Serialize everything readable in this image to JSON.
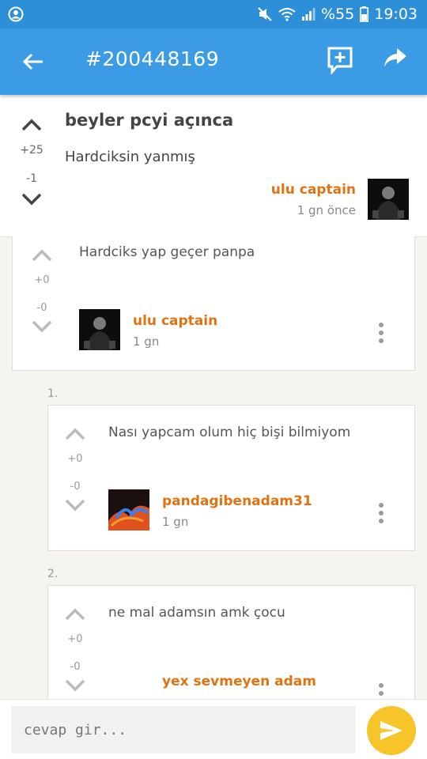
{
  "status_bar": {
    "battery": "%55",
    "time": "19:03"
  },
  "app_bar": {
    "title": "#200448169"
  },
  "post": {
    "title": "beyler pcyi açınca",
    "body": "Hardciksin yanmış",
    "upvotes": "+25",
    "downvotes": "-1",
    "author": "ulu captain",
    "time": "1 gn  önce"
  },
  "comments": [
    {
      "index": "",
      "text": "Hardciks yap geçer panpa",
      "upvotes": "+0",
      "downvotes": "-0",
      "author": "ulu captain",
      "time": "1 gn"
    },
    {
      "index": "1.",
      "text": "Nası yapcam olum hiç bişi bilmiyom",
      "upvotes": "+0",
      "downvotes": "-0",
      "author": "pandagibenadam31",
      "time": "1 gn"
    },
    {
      "index": "2.",
      "text": "ne mal adamsın amk çocu",
      "upvotes": "+0",
      "downvotes": "-0",
      "author": "yex sevmeyen adam",
      "time": ""
    }
  ],
  "reply": {
    "placeholder": "cevap gir..."
  },
  "colors": {
    "primary": "#3b9be4",
    "status": "#2e8fd9",
    "author": "#e1720f",
    "send": "#f7c42a"
  }
}
